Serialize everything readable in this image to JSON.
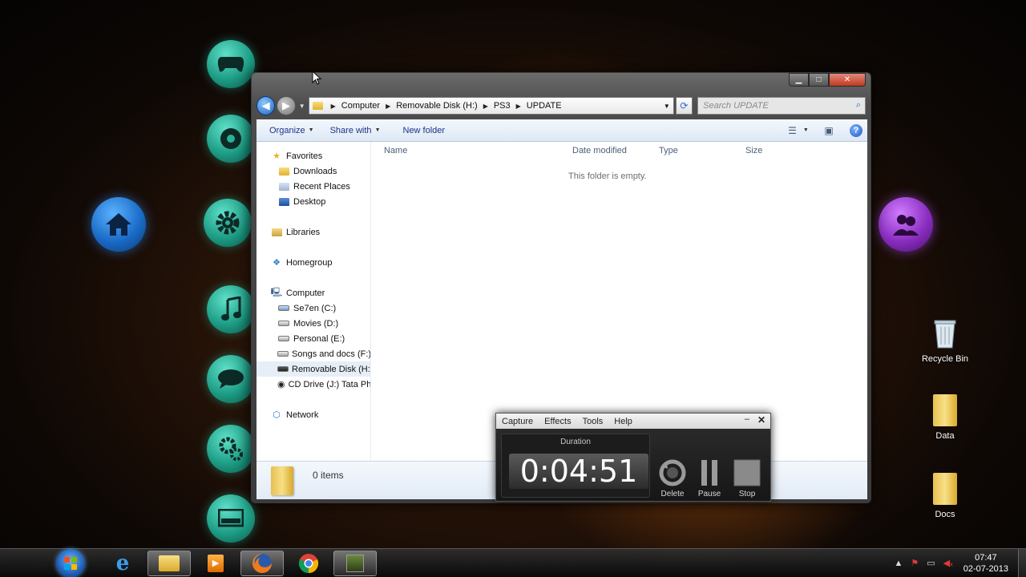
{
  "explorer": {
    "address": [
      "Computer",
      "Removable Disk (H:)",
      "PS3",
      "UPDATE"
    ],
    "search_placeholder": "Search UPDATE",
    "toolbar": {
      "organize": "Organize",
      "share_with": "Share with",
      "new_folder": "New folder"
    },
    "nav": {
      "favorites": "Favorites",
      "downloads": "Downloads",
      "recent_places": "Recent Places",
      "desktop": "Desktop",
      "libraries": "Libraries",
      "homegroup": "Homegroup",
      "computer": "Computer",
      "drive_c": "Se7en (C:)",
      "drive_d": "Movies (D:)",
      "drive_e": "Personal (E:)",
      "drive_f": "Songs and docs (F:)",
      "drive_h": "Removable Disk (H:)",
      "drive_j": "CD Drive (J:) Tata Ph",
      "network": "Network"
    },
    "columns": {
      "name": "Name",
      "date_modified": "Date modified",
      "type": "Type",
      "size": "Size"
    },
    "empty_message": "This folder is empty.",
    "item_count": "0 items"
  },
  "recorder": {
    "menu": {
      "capture": "Capture",
      "effects": "Effects",
      "tools": "Tools",
      "help": "Help"
    },
    "duration_label": "Duration",
    "duration_value": "0:04:51",
    "buttons": {
      "delete": "Delete",
      "pause": "Pause",
      "stop": "Stop"
    }
  },
  "desktop_icons": {
    "recycle_bin": "Recycle Bin",
    "data": "Data",
    "docs": "Docs"
  },
  "taskbar": {
    "time": "07:47",
    "date": "02-07-2013"
  },
  "colors": {
    "explorer_link": "#1e3287",
    "dock_teal": "#1e9e86",
    "home_blue": "#1a6cc8",
    "people_purple": "#8a2ec0"
  },
  "icons": {
    "dock": [
      "gamepad-icon",
      "disc-icon",
      "gear-icon",
      "music-icon",
      "chat-icon",
      "gears-icon",
      "monitor-icon"
    ],
    "home": "home-icon",
    "people": "people-icon"
  }
}
